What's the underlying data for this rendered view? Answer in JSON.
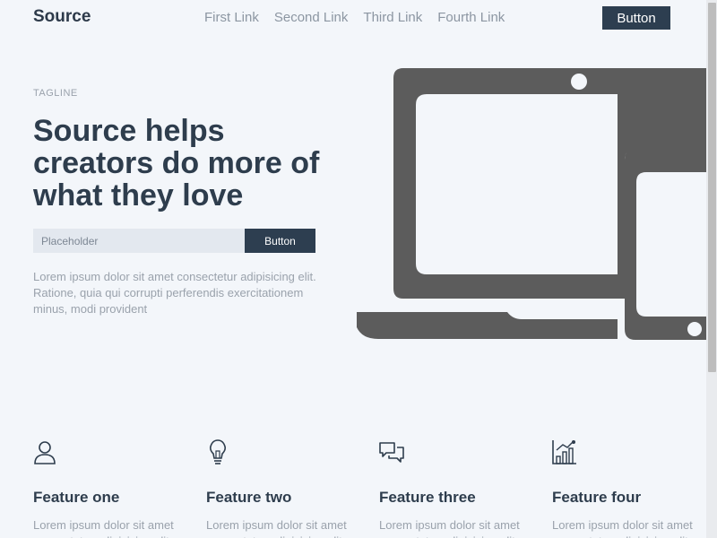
{
  "header": {
    "brand": "Source",
    "nav": [
      "First Link",
      "Second Link",
      "Third Link",
      "Fourth Link"
    ],
    "button_label": "Button"
  },
  "hero": {
    "tagline": "TAGLINE",
    "headline": "Source helps creators do more of what they love",
    "input_placeholder": "Placeholder",
    "button_label": "Button",
    "text": "Lorem ipsum dolor sit amet consectetur adipisicing elit. Ratione, quia qui corrupti perferendis exercitationem minus, modi provident"
  },
  "features": [
    {
      "title": "Feature one",
      "icon": "user-icon",
      "text": "Lorem ipsum dolor sit amet consectetur adipisicing elit."
    },
    {
      "title": "Feature two",
      "icon": "lightbulb-icon",
      "text": "Lorem ipsum dolor sit amet consectetur adipisicing elit."
    },
    {
      "title": "Feature three",
      "icon": "chat-icon",
      "text": "Lorem ipsum dolor sit amet consectetur adipisicing elit."
    },
    {
      "title": "Feature four",
      "icon": "chart-icon",
      "text": "Lorem ipsum dolor sit amet consectetur adipisicing elit."
    }
  ],
  "colors": {
    "background": "#f3f6fa",
    "primary": "#2d3e50",
    "muted_text": "#9aa2ac",
    "device": "#5c5c5c"
  }
}
